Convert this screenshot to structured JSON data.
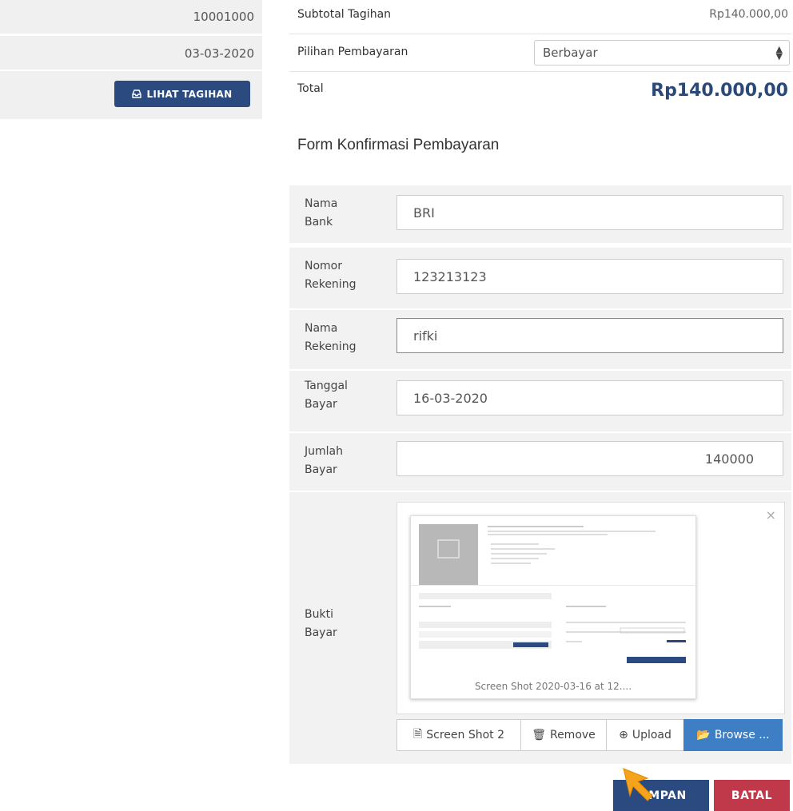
{
  "left_panel": {
    "nomor_value": "10001000",
    "tanggal_value": "03-03-2020",
    "lihat_tagihan_label": "LIHAT TAGIHAN",
    "lihat_tagihan_icon": "inbox-icon"
  },
  "summary": {
    "subtotal_label": "Subtotal Tagihan",
    "subtotal_value": "Rp140.000,00",
    "pilihan_label": "Pilihan Pembayaran",
    "pilihan_selected": "Berbayar",
    "total_label": "Total",
    "total_value": "Rp140.000,00"
  },
  "form": {
    "title": "Form Konfirmasi Pembayaran",
    "fields": [
      {
        "label_line1": "Nama",
        "label_line2": "Bank",
        "value": "BRI"
      },
      {
        "label_line1": "Nomor",
        "label_line2": "Rekening",
        "value": "123213123"
      },
      {
        "label_line1": "Nama",
        "label_line2": "Rekening",
        "value": "rifki"
      },
      {
        "label_line1": "Tanggal",
        "label_line2": "Bayar",
        "value": "16-03-2020"
      },
      {
        "label_line1": "Jumlah",
        "label_line2": "Bayar",
        "value": "140000"
      }
    ],
    "bukti": {
      "label_line1": "Bukti",
      "label_line2": "Bayar",
      "preview_caption": "Screen Shot 2020-03-16 at 12....",
      "file_name": "Screen Shot 2",
      "remove_label": "Remove",
      "upload_label": "Upload",
      "browse_label": "Browse ..."
    }
  },
  "actions": {
    "simpan_label": "SIMPAN",
    "simpan_visible": "MPAN",
    "batal_label": "BATAL"
  },
  "colors": {
    "primary_navy": "#2b4b80",
    "danger_red": "#c0394b",
    "browse_blue": "#3e7ec4",
    "cursor_orange": "#f5a31c"
  }
}
